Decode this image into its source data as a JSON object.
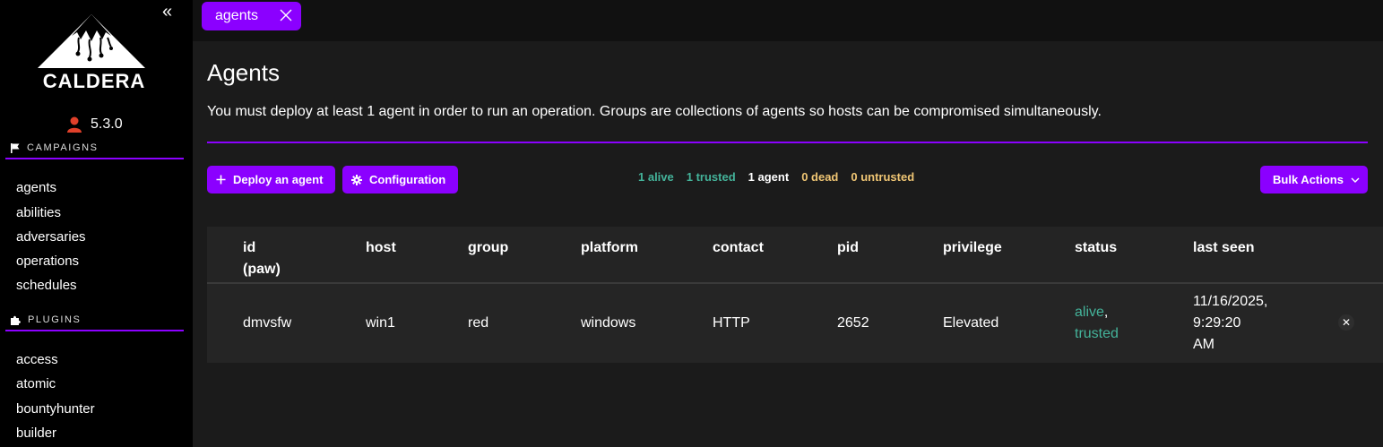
{
  "sidebar": {
    "collapse_glyph": "«",
    "logo_text": "CALDERA",
    "version": "5.3.0",
    "campaigns_label": "CAMPAIGNS",
    "campaign_items": [
      "agents",
      "abilities",
      "adversaries",
      "operations",
      "schedules"
    ],
    "plugins_label": "PLUGINS",
    "plugin_items": [
      "access",
      "atomic",
      "bountyhunter",
      "builder"
    ]
  },
  "tabs": [
    {
      "label": "agents"
    }
  ],
  "page": {
    "title": "Agents",
    "description": "You must deploy at least 1 agent in order to run an operation. Groups are collections of agents so hosts can be compromised simultaneously."
  },
  "toolbar": {
    "deploy_label": "Deploy an agent",
    "config_label": "Configuration",
    "bulk_label": "Bulk Actions"
  },
  "counts": {
    "alive": "1 alive",
    "trusted": "1 trusted",
    "agents": "1 agent",
    "dead": "0 dead",
    "untrusted": "0 untrusted"
  },
  "table": {
    "headers": {
      "id_line1": "id",
      "id_line2": "(paw)",
      "host": "host",
      "group": "group",
      "platform": "platform",
      "contact": "contact",
      "pid": "pid",
      "privilege": "privilege",
      "status": "status",
      "last_seen": "last seen"
    },
    "rows": [
      {
        "paw": "dmvsfw",
        "host": "win1",
        "group": "red",
        "platform": "windows",
        "contact": "HTTP",
        "pid": "2652",
        "privilege": "Elevated",
        "status_alive": "alive",
        "status_sep": ",",
        "status_trusted": "trusted",
        "last_seen_1": "11/16/2025,",
        "last_seen_2": "9:29:20",
        "last_seen_3": "AM",
        "delete_glyph": "✕"
      }
    ]
  },
  "colors": {
    "accent": "#8b00ff",
    "alive": "#44b39a",
    "dead": "#f0c674",
    "sidebar_bg": "#000000",
    "main_bg": "#1b1b1b"
  }
}
